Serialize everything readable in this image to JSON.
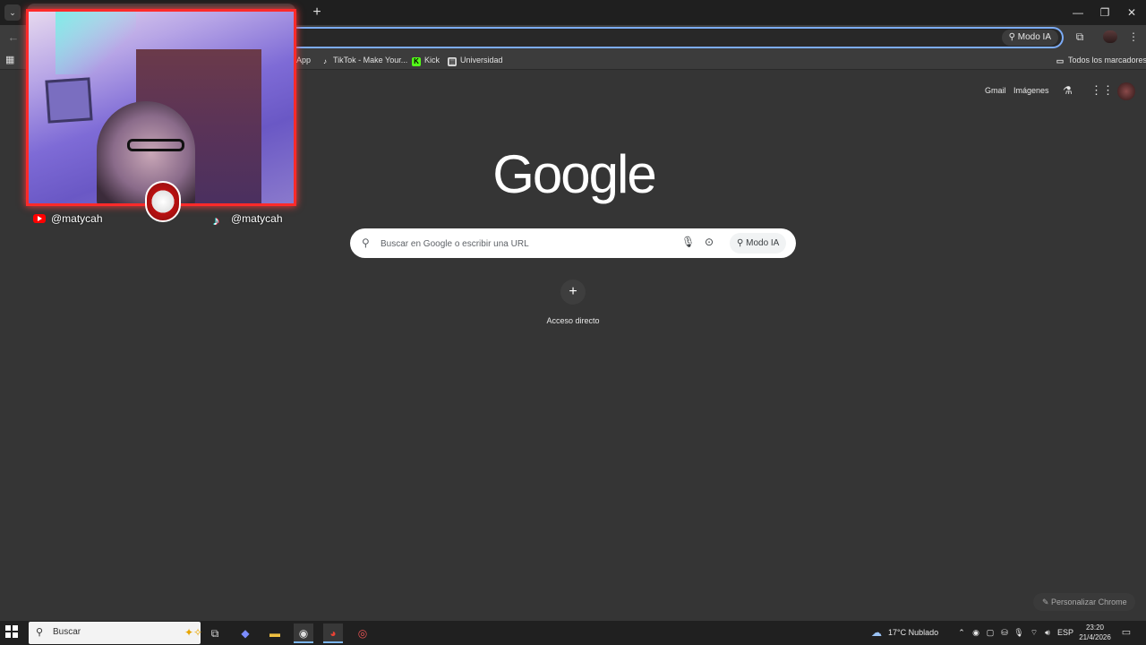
{
  "browser": {
    "omnibox": {
      "ai_mode_label": "Modo IA"
    },
    "bookmarks": [
      {
        "label": "App",
        "icon": "bookmark-partial"
      },
      {
        "label": "TikTok - Make Your...",
        "icon": "tiktok-icon"
      },
      {
        "label": "Kick",
        "icon": "kick-icon",
        "color": "#53fc18"
      },
      {
        "label": "Universidad",
        "icon": "document-icon"
      }
    ],
    "all_bookmarks_label": "Todos los marcadores"
  },
  "ntp": {
    "header": {
      "gmail": "Gmail",
      "images": "Imágenes"
    },
    "logo_text": "Google",
    "search": {
      "placeholder": "Buscar en Google o escribir una URL",
      "ai_mode_label": "Modo IA"
    },
    "shortcut": {
      "label": "Acceso directo"
    },
    "customize_label": "Personalizar Chrome"
  },
  "overlay": {
    "youtube_handle": "@matycah",
    "tiktok_handle": "@matycah",
    "border_color": "#ff2a2a"
  },
  "taskbar": {
    "search_label": "Buscar",
    "weather": "17°C Nublado",
    "language": "ESP",
    "time": "23:20",
    "date": "21/4/2026"
  },
  "colors": {
    "accent": "#7cacf8",
    "background": "#353535"
  }
}
